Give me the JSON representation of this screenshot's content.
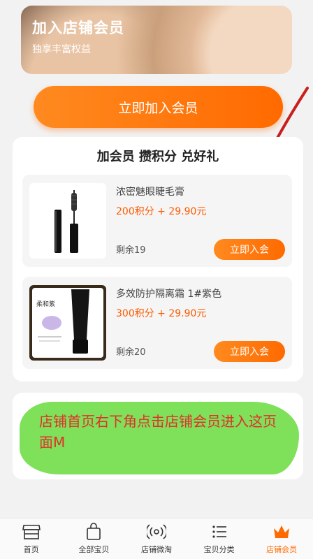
{
  "banner": {
    "title": "加入店铺会员",
    "subtitle": "独享丰富权益"
  },
  "join_button": {
    "label": "立即加入会员"
  },
  "rewards": {
    "title": "加会员 攒积分 兑好礼",
    "items": [
      {
        "name": "浓密魅眼睫毛膏",
        "price": "200积分 + 29.90元",
        "remaining": "剩余19",
        "button": "立即入会",
        "image_icon": "mascara-icon"
      },
      {
        "name": "多效防护隔离霜 1#紫色",
        "price": "300积分 + 29.90元",
        "remaining": "剩余20",
        "button": "立即入会",
        "image_icon": "primer-tube-icon",
        "image_caption": "柔和紫"
      }
    ]
  },
  "annotation": {
    "text": "店铺首页右下角点击店铺会员进入这页面M"
  },
  "tabbar": {
    "items": [
      {
        "label": "首页",
        "icon": "store-icon"
      },
      {
        "label": "全部宝贝",
        "icon": "shopping-bag-icon"
      },
      {
        "label": "店铺微淘",
        "icon": "broadcast-icon"
      },
      {
        "label": "宝贝分类",
        "icon": "list-icon"
      },
      {
        "label": "店铺会员",
        "icon": "crown-icon"
      }
    ],
    "active_color": "#ff6a00"
  },
  "colors": {
    "accent": "#ff6a00",
    "annotation_red": "#e0312a",
    "highlight_green": "#7fe05a"
  }
}
